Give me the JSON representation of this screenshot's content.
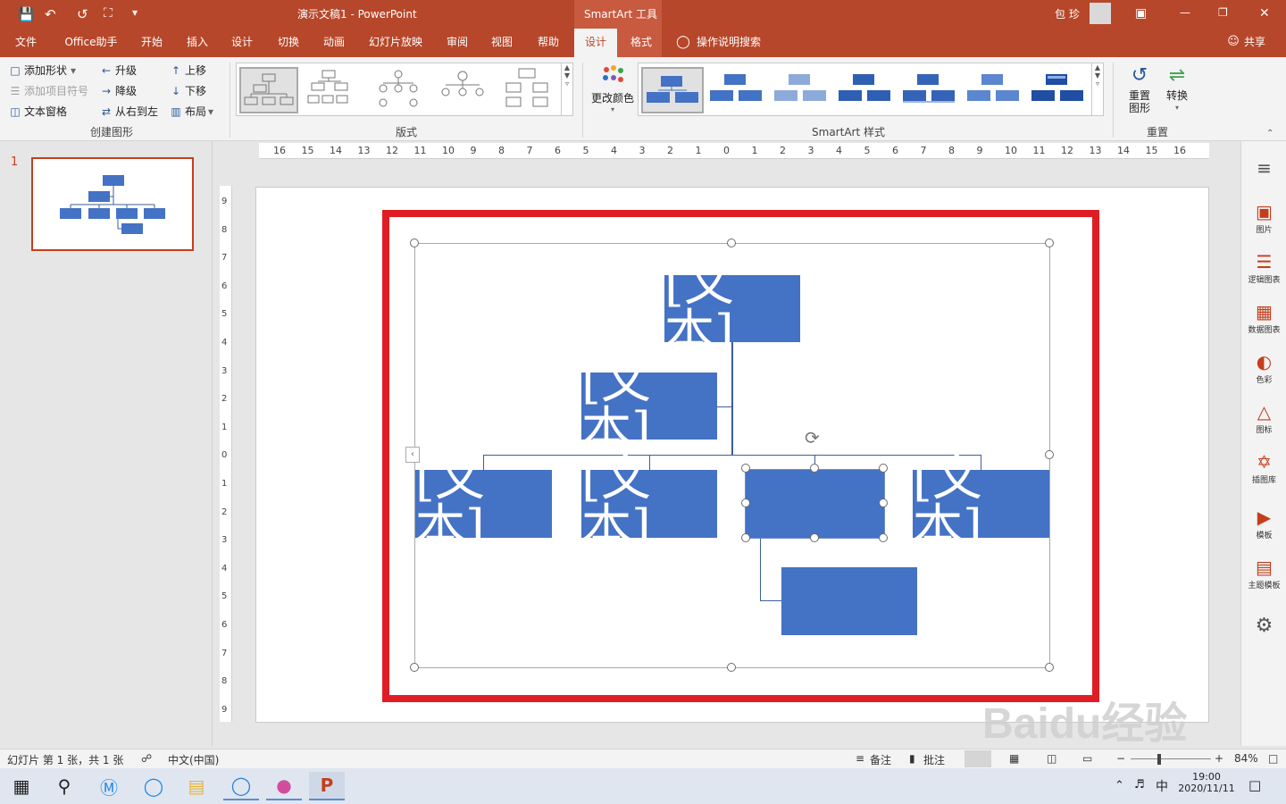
{
  "titlebar": {
    "doc_title": "演示文稿1 - PowerPoint",
    "contextual_tab": "SmartArt 工具",
    "user_name": "包 珍",
    "colors": {
      "accent": "#b7472a",
      "active_tab_text": "#b7472a"
    }
  },
  "tabs": [
    "文件",
    "Office助手",
    "开始",
    "插入",
    "设计",
    "切换",
    "动画",
    "幻灯片放映",
    "审阅",
    "视图",
    "帮助",
    "设计",
    "格式"
  ],
  "tell_me": "操作说明搜索",
  "share": "共享",
  "ribbon": {
    "create_graphic": {
      "add_shape": "添加形状",
      "add_bullet": "添加项目符号",
      "text_pane": "文本窗格",
      "promote": "升级",
      "demote": "降级",
      "right_to_left": "从右到左",
      "move_up": "上移",
      "move_down": "下移",
      "layout": "布局",
      "label": "创建图形"
    },
    "layouts": {
      "label": "版式"
    },
    "change_colors": "更改颜色",
    "styles": {
      "label": "SmartArt 样式"
    },
    "reset": {
      "reset_graphic_line1": "重置",
      "reset_graphic_line2": "图形",
      "convert": "转换",
      "label": "重置"
    }
  },
  "slides_panel": {
    "slide_number": "1"
  },
  "rulers": {
    "horizontal": [
      "16",
      "15",
      "14",
      "13",
      "12",
      "11",
      "10",
      "9",
      "8",
      "7",
      "6",
      "5",
      "4",
      "3",
      "2",
      "1",
      "0",
      "1",
      "2",
      "3",
      "4",
      "5",
      "6",
      "7",
      "8",
      "9",
      "10",
      "11",
      "12",
      "13",
      "14",
      "15",
      "16"
    ],
    "vertical": [
      "9",
      "8",
      "7",
      "6",
      "5",
      "4",
      "3",
      "2",
      "1",
      "0",
      "1",
      "2",
      "3",
      "4",
      "5",
      "6",
      "7",
      "8",
      "9"
    ]
  },
  "slide": {
    "nodes": {
      "top": "[文本]",
      "assistant": "[文本]",
      "child1": "[文本]",
      "child2": "[文本]",
      "child3": "",
      "child4": "[文本]",
      "sub": ""
    },
    "node_color": "#4472c4",
    "frame_color": "#e01d24"
  },
  "right_pane": [
    "图片",
    "逻辑图表",
    "数据图表",
    "色彩",
    "图标",
    "插图库",
    "模板",
    "主题模板"
  ],
  "statusbar": {
    "slide_info": "幻灯片 第 1 张，共 1 张",
    "language": "中文(中国)",
    "notes": "备注",
    "comments": "批注",
    "zoom": "84%"
  },
  "taskbar": {
    "ime": "中",
    "time": "19:00",
    "date": "2020/11/11"
  },
  "watermark": "Baidu经验"
}
